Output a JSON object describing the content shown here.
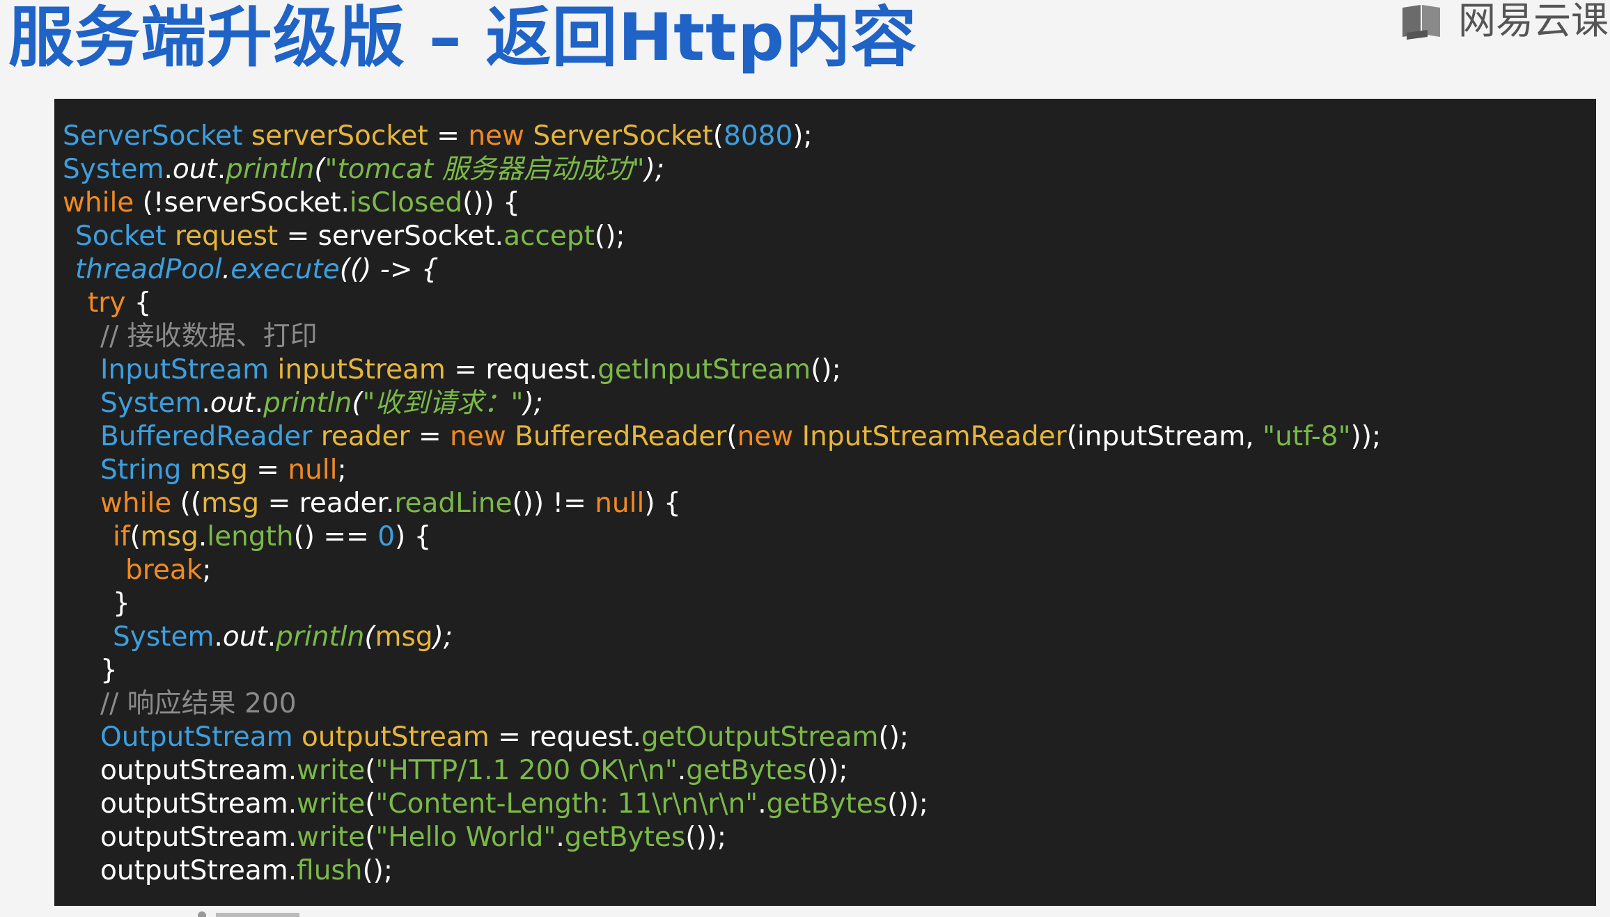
{
  "slide": {
    "title": "服务端升级版 – 返回Http内容",
    "page_marker": "",
    "brand": "网易云课"
  },
  "colors": {
    "title": "#1f63c6",
    "panel_bg": "#1f1f1f",
    "type": "#3c9fe0",
    "keyword": "#f08a22",
    "identifier": "#e6b63a",
    "method_string": "#7ab947",
    "comment": "#8a8a8a",
    "plain": "#ffffff"
  },
  "code_lines": [
    {
      "indent": 0,
      "tokens": [
        {
          "t": "ServerSocket",
          "c": "type"
        },
        {
          "t": " ",
          "c": "plain"
        },
        {
          "t": "serverSocket",
          "c": "id"
        },
        {
          "t": " = ",
          "c": "plain"
        },
        {
          "t": "new",
          "c": "kw"
        },
        {
          "t": " ",
          "c": "plain"
        },
        {
          "t": "ServerSocket",
          "c": "id"
        },
        {
          "t": "(",
          "c": "plain"
        },
        {
          "t": "8080",
          "c": "num"
        },
        {
          "t": ");",
          "c": "plain"
        }
      ]
    },
    {
      "indent": 0,
      "tokens": [
        {
          "t": "System",
          "c": "type"
        },
        {
          "t": ".",
          "c": "plain"
        },
        {
          "t": "out",
          "c": "fld",
          "i": true
        },
        {
          "t": ".",
          "c": "plain"
        },
        {
          "t": "println",
          "c": "method",
          "i": true
        },
        {
          "t": "(",
          "c": "plain",
          "i": true
        },
        {
          "t": "\"tomcat 服务器启动成功\"",
          "c": "str",
          "i": true
        },
        {
          "t": ");",
          "c": "plain",
          "i": true
        }
      ]
    },
    {
      "indent": 0,
      "tokens": [
        {
          "t": "while",
          "c": "kw"
        },
        {
          "t": " (!serverSocket.",
          "c": "plain"
        },
        {
          "t": "isClosed",
          "c": "method"
        },
        {
          "t": "()) {",
          "c": "plain"
        }
      ]
    },
    {
      "indent": 1,
      "tokens": [
        {
          "t": "Socket",
          "c": "type"
        },
        {
          "t": " ",
          "c": "plain"
        },
        {
          "t": "request",
          "c": "id"
        },
        {
          "t": " = serverSocket.",
          "c": "plain"
        },
        {
          "t": "accept",
          "c": "method"
        },
        {
          "t": "();",
          "c": "plain"
        }
      ]
    },
    {
      "indent": 1,
      "tokens": [
        {
          "t": "threadPool",
          "c": "type",
          "i": true
        },
        {
          "t": ".",
          "c": "plain",
          "i": true
        },
        {
          "t": "execute",
          "c": "type",
          "i": true
        },
        {
          "t": "(() -> {",
          "c": "plain",
          "i": true
        }
      ]
    },
    {
      "indent": 2,
      "tokens": [
        {
          "t": "try",
          "c": "kw"
        },
        {
          "t": " {",
          "c": "plain"
        }
      ]
    },
    {
      "indent": 3,
      "tokens": [
        {
          "t": "// 接收数据、打印",
          "c": "cmt"
        }
      ]
    },
    {
      "indent": 3,
      "tokens": [
        {
          "t": "InputStream",
          "c": "type"
        },
        {
          "t": " ",
          "c": "plain"
        },
        {
          "t": "inputStream",
          "c": "id"
        },
        {
          "t": " = request.",
          "c": "plain"
        },
        {
          "t": "getInputStream",
          "c": "method"
        },
        {
          "t": "();",
          "c": "plain"
        }
      ]
    },
    {
      "indent": 3,
      "tokens": [
        {
          "t": "System",
          "c": "type"
        },
        {
          "t": ".",
          "c": "plain"
        },
        {
          "t": "out",
          "c": "fld",
          "i": true
        },
        {
          "t": ".",
          "c": "plain"
        },
        {
          "t": "println",
          "c": "method",
          "i": true
        },
        {
          "t": "(",
          "c": "plain",
          "i": true
        },
        {
          "t": "\"收到请求：\"",
          "c": "str",
          "i": true
        },
        {
          "t": ");",
          "c": "plain",
          "i": true
        }
      ]
    },
    {
      "indent": 3,
      "tokens": [
        {
          "t": "BufferedReader",
          "c": "type"
        },
        {
          "t": " ",
          "c": "plain"
        },
        {
          "t": "reader",
          "c": "id"
        },
        {
          "t": " = ",
          "c": "plain"
        },
        {
          "t": "new",
          "c": "kw"
        },
        {
          "t": " ",
          "c": "plain"
        },
        {
          "t": "BufferedReader",
          "c": "id"
        },
        {
          "t": "(",
          "c": "plain"
        },
        {
          "t": "new",
          "c": "kw"
        },
        {
          "t": " ",
          "c": "plain"
        },
        {
          "t": "InputStreamReader",
          "c": "id"
        },
        {
          "t": "(inputStream, ",
          "c": "plain"
        },
        {
          "t": "\"utf-8\"",
          "c": "str"
        },
        {
          "t": "));",
          "c": "plain"
        }
      ]
    },
    {
      "indent": 3,
      "tokens": [
        {
          "t": "String",
          "c": "type"
        },
        {
          "t": " ",
          "c": "plain"
        },
        {
          "t": "msg",
          "c": "id"
        },
        {
          "t": " = ",
          "c": "plain"
        },
        {
          "t": "null",
          "c": "kw"
        },
        {
          "t": ";",
          "c": "plain"
        }
      ]
    },
    {
      "indent": 3,
      "tokens": [
        {
          "t": "while",
          "c": "kw"
        },
        {
          "t": " ((",
          "c": "plain"
        },
        {
          "t": "msg",
          "c": "id"
        },
        {
          "t": " = reader.",
          "c": "plain"
        },
        {
          "t": "readLine",
          "c": "method"
        },
        {
          "t": "()) != ",
          "c": "plain"
        },
        {
          "t": "null",
          "c": "kw"
        },
        {
          "t": ") {",
          "c": "plain"
        }
      ]
    },
    {
      "indent": 4,
      "tokens": [
        {
          "t": "if",
          "c": "kw"
        },
        {
          "t": "(",
          "c": "plain"
        },
        {
          "t": "msg",
          "c": "id"
        },
        {
          "t": ".",
          "c": "plain"
        },
        {
          "t": "length",
          "c": "method"
        },
        {
          "t": "() == ",
          "c": "plain"
        },
        {
          "t": "0",
          "c": "num"
        },
        {
          "t": ") {",
          "c": "plain"
        }
      ]
    },
    {
      "indent": 5,
      "tokens": [
        {
          "t": "break",
          "c": "kw"
        },
        {
          "t": ";",
          "c": "plain"
        }
      ]
    },
    {
      "indent": 4,
      "tokens": [
        {
          "t": "}",
          "c": "plain"
        }
      ]
    },
    {
      "indent": 4,
      "tokens": [
        {
          "t": "System",
          "c": "type"
        },
        {
          "t": ".",
          "c": "plain"
        },
        {
          "t": "out",
          "c": "fld",
          "i": true
        },
        {
          "t": ".",
          "c": "plain"
        },
        {
          "t": "println",
          "c": "method",
          "i": true
        },
        {
          "t": "(",
          "c": "plain",
          "i": true
        },
        {
          "t": "msg",
          "c": "id"
        },
        {
          "t": ");",
          "c": "plain",
          "i": true
        }
      ]
    },
    {
      "indent": 3,
      "tokens": [
        {
          "t": "}",
          "c": "plain"
        }
      ]
    },
    {
      "indent": 3,
      "tokens": [
        {
          "t": "// 响应结果 200",
          "c": "cmt"
        }
      ]
    },
    {
      "indent": 3,
      "tokens": [
        {
          "t": "OutputStream",
          "c": "type"
        },
        {
          "t": " ",
          "c": "plain"
        },
        {
          "t": "outputStream",
          "c": "id"
        },
        {
          "t": " = request.",
          "c": "plain"
        },
        {
          "t": "getOutputStream",
          "c": "method"
        },
        {
          "t": "();",
          "c": "plain"
        }
      ]
    },
    {
      "indent": 3,
      "tokens": [
        {
          "t": "outputStream.",
          "c": "plain"
        },
        {
          "t": "write",
          "c": "method"
        },
        {
          "t": "(",
          "c": "plain"
        },
        {
          "t": "\"HTTP/1.1 200 OK\\r\\n\"",
          "c": "str"
        },
        {
          "t": ".",
          "c": "plain"
        },
        {
          "t": "getBytes",
          "c": "method"
        },
        {
          "t": "());",
          "c": "plain"
        }
      ]
    },
    {
      "indent": 3,
      "tokens": [
        {
          "t": "outputStream.",
          "c": "plain"
        },
        {
          "t": "write",
          "c": "method"
        },
        {
          "t": "(",
          "c": "plain"
        },
        {
          "t": "\"Content-Length: 11\\r\\n\\r\\n\"",
          "c": "str"
        },
        {
          "t": ".",
          "c": "plain"
        },
        {
          "t": "getBytes",
          "c": "method"
        },
        {
          "t": "());",
          "c": "plain"
        }
      ]
    },
    {
      "indent": 3,
      "tokens": [
        {
          "t": "outputStream.",
          "c": "plain"
        },
        {
          "t": "write",
          "c": "method"
        },
        {
          "t": "(",
          "c": "plain"
        },
        {
          "t": "\"Hello World\"",
          "c": "str"
        },
        {
          "t": ".",
          "c": "plain"
        },
        {
          "t": "getBytes",
          "c": "method"
        },
        {
          "t": "());",
          "c": "plain"
        }
      ]
    },
    {
      "indent": 3,
      "tokens": [
        {
          "t": "outputStream.",
          "c": "plain"
        },
        {
          "t": "flush",
          "c": "method"
        },
        {
          "t": "();",
          "c": "plain"
        }
      ]
    }
  ]
}
